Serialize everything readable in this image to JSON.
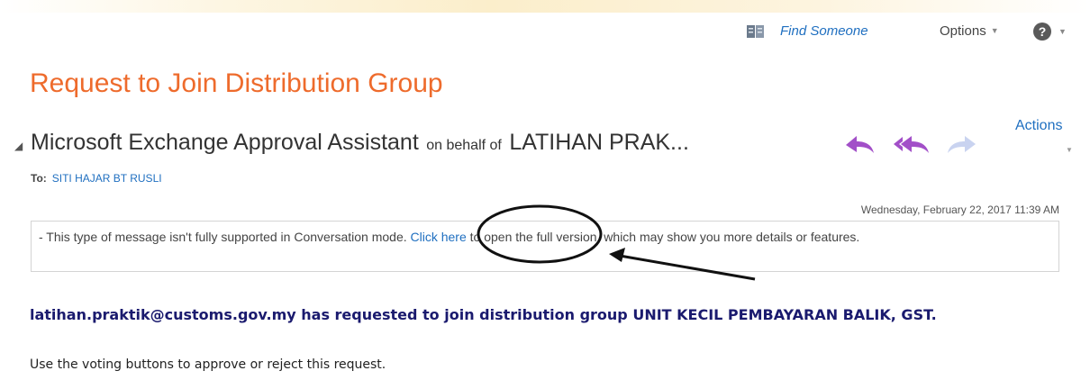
{
  "topbar": {
    "find_someone": "Find Someone",
    "options": "Options",
    "help_symbol": "?",
    "caret": "▼"
  },
  "page": {
    "title": "Request to Join Distribution Group"
  },
  "header": {
    "actions_label": "Actions",
    "collapse_symbol": "◢",
    "sender": "Microsoft Exchange Approval Assistant",
    "on_behalf_text": "on behalf of",
    "behalf_name": "LATIHAN PRAK...",
    "to_label": "To:",
    "to_value": "SITI HAJAR BT RUSLI",
    "timestamp": "Wednesday, February 22, 2017 11:39 AM",
    "icons": [
      "reply-icon",
      "reply-all-icon",
      "forward-icon",
      "address-book-icon",
      "help-icon"
    ]
  },
  "info_box": {
    "text_before": "- This type of message isn't fully supported in Conversation mode. ",
    "link_text": "Click here",
    "text_after": " to open the full version, which may show you more details or features."
  },
  "body": {
    "request_line": "latihan.praktik@customs.gov.my has requested to join distribution group UNIT KECIL PEMBAYARAN BALIK, GST.",
    "voting_line": "Use the voting buttons to approve or reject this request."
  },
  "colors": {
    "title_orange": "#ee6b2c",
    "link_blue": "#1f6fc0",
    "action_purple": "#a24fc8",
    "request_navy": "#1a1a6e"
  }
}
